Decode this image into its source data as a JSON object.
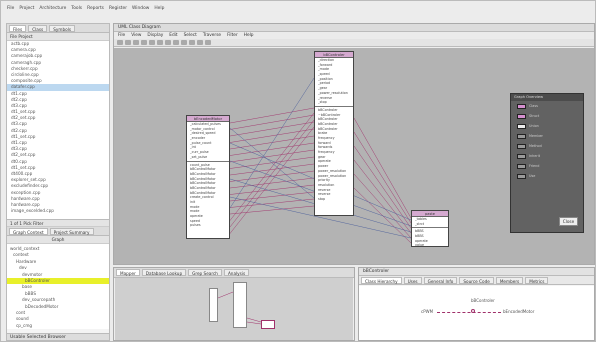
{
  "app_menu": [
    "File",
    "Project",
    "Architecture",
    "Tools",
    "Reports",
    "Register",
    "Window",
    "Help"
  ],
  "left_tabs": [
    "Files",
    "Class",
    "Symbols"
  ],
  "file_header": "File Project",
  "files": [
    "actb.cpp",
    "camera.cpp",
    "camerajob.cpp",
    "cameragh.cpp",
    "checkerr.cpp",
    "circloline.cpp",
    "composite.cpp",
    "datafer.cpp",
    "dt1.cpp",
    "dt2.cpp",
    "dt3.cpp",
    "dt1_set.cpp",
    "dt2_set.cpp",
    "dt3.cpp",
    "dt2.cpp",
    "dt1_set.cpp",
    "dt1.cpp",
    "dt3.cpp",
    "dt2_set.cpp",
    "dt0.cpp",
    "dt1_set.cpp",
    "dt400.cpp",
    "explorer_set.cpp",
    "excludefinder.cpp",
    "exception.cpp",
    "hardware.cpp",
    "hardware.cpp",
    "image_excelded.cpp"
  ],
  "left_midbar": "1  of 1  Pick  Filter",
  "graph_tabs": [
    "Graph Context",
    "Project Summary"
  ],
  "graph_label": "Graph",
  "tree_nodes": [
    {
      "label": "world_context",
      "indent": 3
    },
    {
      "label": "context",
      "indent": 6
    },
    {
      "label": "Hardware",
      "indent": 9
    },
    {
      "label": "dev",
      "indent": 12
    },
    {
      "label": "devmotor",
      "indent": 15
    },
    {
      "label": "bBControler",
      "indent": 18,
      "hl": true
    },
    {
      "label": "base",
      "indent": 15
    },
    {
      "label": "bBBS",
      "indent": 18
    },
    {
      "label": "dev_sourcepath",
      "indent": 15
    },
    {
      "label": "bDecodedMotor",
      "indent": 18
    },
    {
      "label": "cont",
      "indent": 9
    },
    {
      "label": "sound",
      "indent": 9
    },
    {
      "label": "cp_cmg",
      "indent": 9
    }
  ],
  "left_status": "Usable  Selected  Browser",
  "diagram": {
    "title": "UML Class Diagram",
    "menu": [
      "File",
      "View",
      "Display",
      "Edit",
      "Select",
      "Traverse",
      "Filter",
      "Help"
    ],
    "classes": [
      {
        "name": "bBControler",
        "attrs": [
          "_direction",
          "_forward",
          "_mode",
          "_speed",
          "_position",
          "_period",
          "_gear",
          "_power_resolution",
          "_reverse",
          "_stop"
        ],
        "methods": [
          "bBControler",
          "~bBControler",
          "bBControler",
          "bBControler",
          "bBControler",
          "brake",
          "frequency",
          "forward",
          "forwards",
          "frequency",
          "gear",
          "operate",
          "power",
          "power_resolution",
          "power_resolution",
          "priority",
          "resolution",
          "reverse",
          "reverse",
          "stop"
        ]
      },
      {
        "name": "bEncodedMotor",
        "attrs": [
          "_calculated_pulses",
          "_motor_control",
          "_desired_speed",
          "_encoder",
          "_pulse_count",
          "_int",
          "_curr_pulse",
          "_set_pulse"
        ],
        "methods": [
          "count_pulse",
          "bBControlMotor",
          "bBControlMotor",
          "bBControlMotor",
          "bBControlMotor",
          "bBControlMotor",
          "bBControlMotor",
          "create_control",
          "init",
          "mode",
          "mode",
          "operate",
          "speed",
          "pulses"
        ]
      },
      {
        "name": "paste",
        "attrs": [
          "_tables",
          "_strct"
        ],
        "methods": [
          "bBBS",
          "bBBS",
          "operate",
          "value"
        ]
      }
    ]
  },
  "overview": {
    "title": "Graph Overview",
    "items": [
      {
        "label": "Class",
        "color": "#d58fcf"
      },
      {
        "label": "Struct",
        "color": "#d58fcf"
      },
      {
        "label": "Union",
        "color": "#ededed"
      },
      {
        "label": "Member",
        "color": "#9a9a9a"
      },
      {
        "label": "Method",
        "color": "#9a9a9a"
      },
      {
        "label": "Inherit",
        "color": "#9a9a9a"
      },
      {
        "label": "Friend",
        "color": "#9a9a9a"
      },
      {
        "label": "Use",
        "color": "#9a9a9a"
      }
    ],
    "close_label": "Close"
  },
  "bottom_left_tabs": [
    "Mapper",
    "Database Lookup",
    "Grep Search",
    "Analysis"
  ],
  "bottom_right": {
    "title": "bBControler",
    "tabs": [
      "Class Hierarchy",
      "Uses",
      "General Info",
      "Source Code",
      "Members",
      "Metrics"
    ],
    "node_label": "bBControler",
    "left_class": "cPWM",
    "right_class": "bEncodedMotor"
  },
  "colors": {
    "class_header": "#d5a9d0",
    "link_pink": "#a0306a",
    "link_blue": "#4a5e9a",
    "canvas": "#b3b3b3",
    "highlight": "#e8f02a"
  }
}
